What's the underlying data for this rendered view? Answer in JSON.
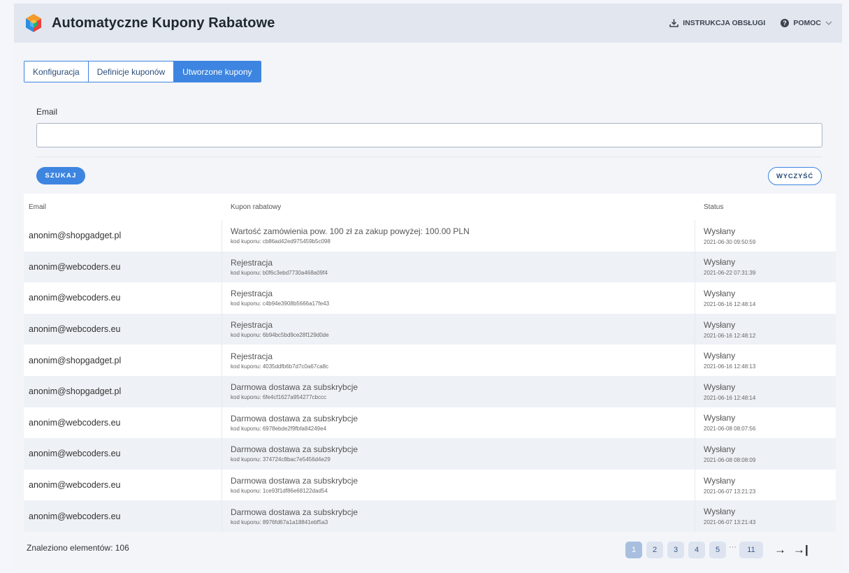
{
  "header": {
    "title": "Automatyczne Kupony Rabatowe",
    "manual_label": "INSTRUKCJA OBSŁUGI",
    "help_label": "POMOC"
  },
  "tabs": [
    {
      "label": "Konfiguracja"
    },
    {
      "label": "Definicje kuponów"
    },
    {
      "label": "Utworzone kupony"
    }
  ],
  "form": {
    "email_label": "Email",
    "email_value": "",
    "search_label": "SZUKAJ",
    "clear_label": "WYCZYŚĆ"
  },
  "table": {
    "headers": {
      "email": "Email",
      "coupon": "Kupon rabatowy",
      "status": "Status"
    },
    "rows": [
      {
        "email": "anonim@shopgadget.pl",
        "coupon": "Wartość zamówienia pow. 100 zł za zakup powyżej: 100.00 PLN",
        "code": "kod kuponu: cb86ad42ed975459b5c098",
        "status": "Wysłany",
        "date": "2021-06-30 09:50:59"
      },
      {
        "email": "anonim@webcoders.eu",
        "coupon": "Rejestracja",
        "code": "kod kuponu: b0f6c3ebd7730a468a09f4",
        "status": "Wysłany",
        "date": "2021-06-22 07:31:39"
      },
      {
        "email": "anonim@webcoders.eu",
        "coupon": "Rejestracja",
        "code": "kod kuponu: c4b94e3908b5666a17fe43",
        "status": "Wysłany",
        "date": "2021-06-16 12:48:14"
      },
      {
        "email": "anonim@webcoders.eu",
        "coupon": "Rejestracja",
        "code": "kod kuponu: 6b94bc5bd9ce28f129d0de",
        "status": "Wysłany",
        "date": "2021-06-16 12:48:12"
      },
      {
        "email": "anonim@shopgadget.pl",
        "coupon": "Rejestracja",
        "code": "kod kuponu: 4035ddfb6b7d7c0a67ca8c",
        "status": "Wysłany",
        "date": "2021-06-16 12:48:13"
      },
      {
        "email": "anonim@shopgadget.pl",
        "coupon": "Darmowa dostawa za subskrybcje",
        "code": "kod kuponu: 6fe4cf1627a954277cbccc",
        "status": "Wysłany",
        "date": "2021-06-16 12:48:14"
      },
      {
        "email": "anonim@webcoders.eu",
        "coupon": "Darmowa dostawa za subskrybcje",
        "code": "kod kuponu: 6978ebde2f9fbfa84249e4",
        "status": "Wysłany",
        "date": "2021-06-08 08:07:56"
      },
      {
        "email": "anonim@webcoders.eu",
        "coupon": "Darmowa dostawa za subskrybcje",
        "code": "kod kuponu: 374724c8bac7e5456d4e29",
        "status": "Wysłany",
        "date": "2021-06-08 08:08:09"
      },
      {
        "email": "anonim@webcoders.eu",
        "coupon": "Darmowa dostawa za subskrybcje",
        "code": "kod kuponu: 1ce93f1df86e68122dad54",
        "status": "Wysłany",
        "date": "2021-06-07 13:21:23"
      },
      {
        "email": "anonim@webcoders.eu",
        "coupon": "Darmowa dostawa za subskrybcje",
        "code": "kod kuponu: 8976fd67a1a18841ebf5a3",
        "status": "Wysłany",
        "date": "2021-06-07 13:21:43"
      }
    ]
  },
  "footer": {
    "found_label": "Znaleziono elementów: 106"
  },
  "pagination": {
    "pages": [
      "1",
      "2",
      "3",
      "4",
      "5"
    ],
    "ellipsis": "···",
    "last_page": "11",
    "current": "1",
    "next_symbol": "→",
    "last_symbol": "→|"
  },
  "colors": {
    "accent": "#3d85e0",
    "header_bg": "#e2e6ef",
    "page_bg": "#f3f5f9"
  }
}
